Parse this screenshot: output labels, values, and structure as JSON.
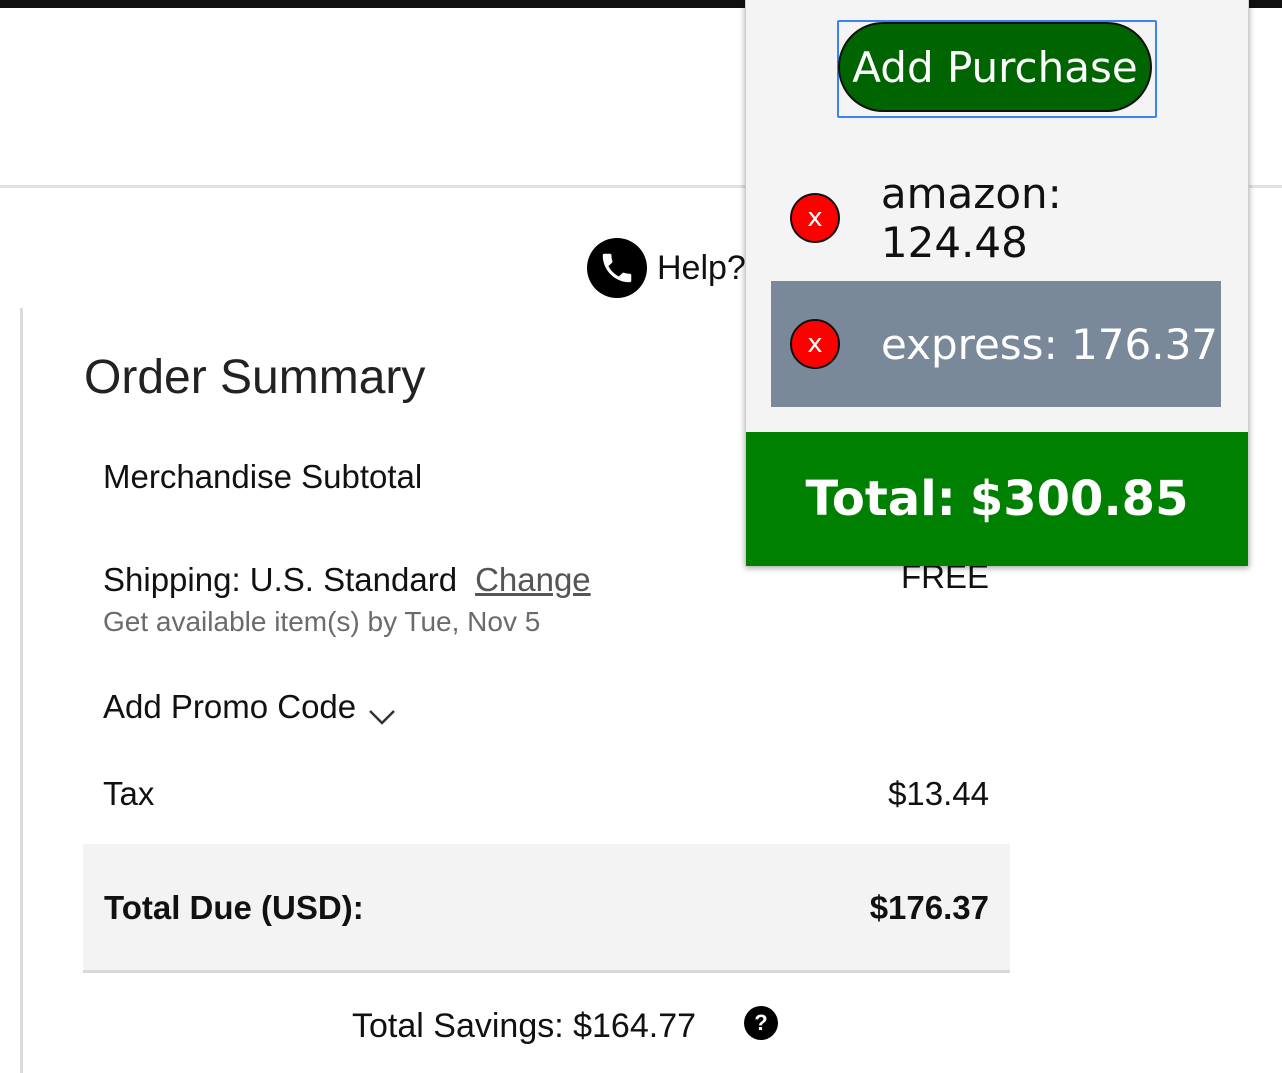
{
  "page": {
    "help_label": "Help?",
    "order_summary": {
      "title": "Order Summary",
      "merchandise_subtotal_label": "Merchandise Subtotal",
      "shipping_label": "Shipping: U.S. Standard",
      "shipping_change_link": "Change",
      "shipping_value": "FREE",
      "shipping_estimate": "Get available item(s) by Tue, Nov 5",
      "promo_label": "Add Promo Code",
      "tax_label": "Tax",
      "tax_value": "$13.44",
      "total_due_label": "Total Due (USD):",
      "total_due_value": "$176.37",
      "total_savings": "Total Savings: $164.77",
      "savings_help_glyph": "?"
    }
  },
  "popup": {
    "add_button_label": "Add Purchase",
    "purchases": [
      {
        "label": "amazon: 124.48",
        "remove_glyph": "x",
        "selected": false
      },
      {
        "label": "express: 176.37",
        "remove_glyph": "x",
        "selected": true
      }
    ],
    "total_label": "Total:",
    "total_value": "$300.85"
  },
  "colors": {
    "add_button_bg": "#006400",
    "remove_button_bg": "#ff0000",
    "selected_row_bg": "#798999",
    "total_bar_bg": "#008000",
    "focus_ring": "#3b82f6"
  },
  "icons": {
    "help": "phone-icon",
    "promo": "chevron-down-icon",
    "savings": "question-icon"
  }
}
